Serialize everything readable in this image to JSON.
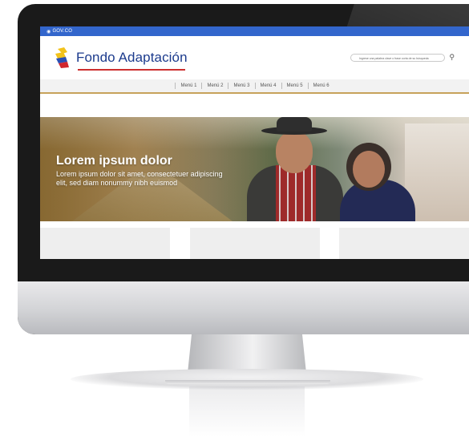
{
  "gov_bar": {
    "label": "GOV.CO"
  },
  "header": {
    "logo_text": "Fondo Adaptación",
    "search_placeholder": "Ingrese una palabra clave o frase corta de su búsqueda"
  },
  "menu": {
    "items": [
      "Menú 1",
      "Menú 2",
      "Menú 3",
      "Menú 4",
      "Menú 5",
      "Menú 6"
    ]
  },
  "hero": {
    "title": "Lorem ipsum dolor",
    "text": "Lorem ipsum dolor sit amet, consectetuer adipiscing elit, sed diam nonummy nibh euismod"
  },
  "colors": {
    "gov_blue": "#3366cc",
    "logo_blue": "#1c3b8d",
    "accent_gold": "#c7a25a",
    "accent_red": "#cc2f2f"
  }
}
